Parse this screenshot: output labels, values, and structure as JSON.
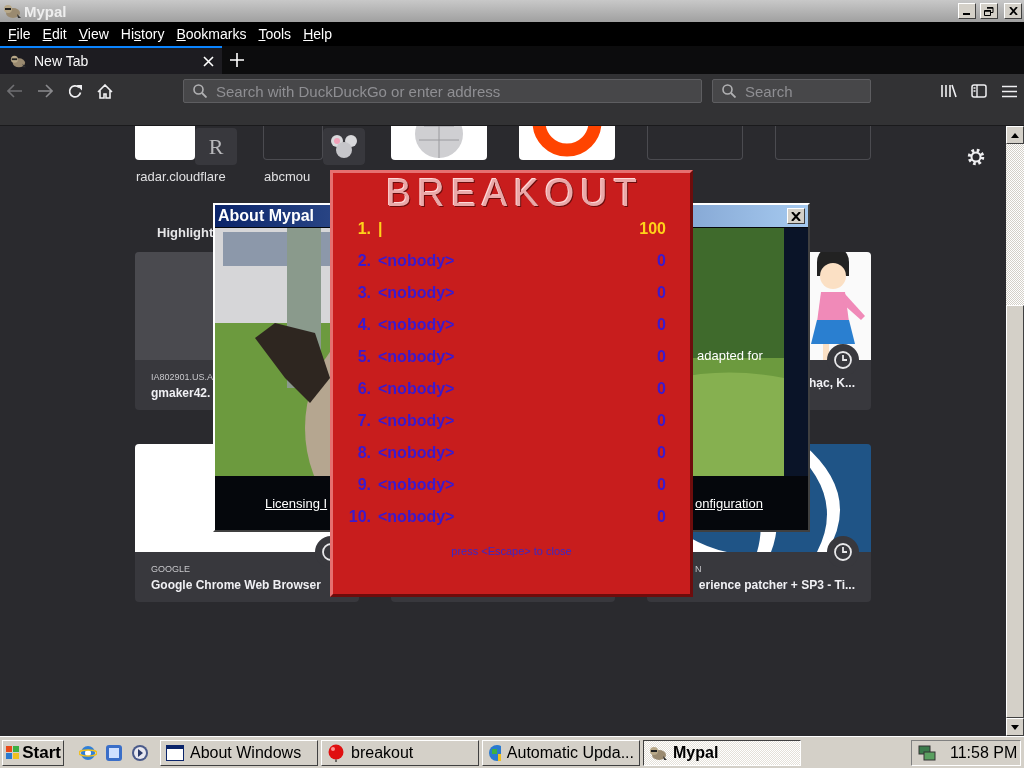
{
  "window": {
    "title": "Mypal"
  },
  "menu": [
    {
      "key": "F",
      "rest": "ile"
    },
    {
      "key": "E",
      "rest": "dit"
    },
    {
      "key": "V",
      "rest": "iew"
    },
    {
      "lead": "Hi",
      "key": "s",
      "rest": "tory"
    },
    {
      "key": "B",
      "rest": "ookmarks"
    },
    {
      "key": "T",
      "rest": "ools"
    },
    {
      "key": "H",
      "rest": "elp"
    }
  ],
  "tabs": [
    {
      "label": "New Tab",
      "selected": true
    }
  ],
  "toolbar": {
    "address_placeholder": "Search with DuckDuckGo or enter address",
    "search_placeholder": "Search"
  },
  "top_sites": [
    {
      "kind": "letter",
      "badge": "R",
      "label": "radar.cloudflare"
    },
    {
      "kind": "mouse",
      "label": "abcmou"
    },
    {
      "kind": "globe"
    },
    {
      "kind": "ring"
    },
    {
      "kind": "empty"
    },
    {
      "kind": "empty"
    }
  ],
  "highlights": {
    "title": "Highlight",
    "cards": [
      {
        "kind": "gray",
        "source": "IA802901.US.A",
        "title": "gmaker42."
      },
      {
        "kind": "figure",
        "title": "hạc, K...",
        "history": true
      },
      {
        "kind": "white",
        "source": "GOOGLE",
        "title": "Google Chrome Web Browser",
        "history": true
      },
      {
        "kind": "covered"
      },
      {
        "kind": "waves",
        "source": "N",
        "title": "erience patcher + SP3 - Ti...",
        "history": true
      }
    ]
  },
  "about": {
    "title": "About Mypal",
    "caption": "adapted for",
    "links": [
      "Licensing I",
      "onfiguration"
    ]
  },
  "breakout": {
    "title": "BREAKOUT",
    "scores": [
      {
        "rank": "1.",
        "name": "|",
        "score": "100",
        "current": true
      },
      {
        "rank": "2.",
        "name": "<nobody>",
        "score": "0",
        "current": false
      },
      {
        "rank": "3.",
        "name": "<nobody>",
        "score": "0",
        "current": false
      },
      {
        "rank": "4.",
        "name": "<nobody>",
        "score": "0",
        "current": false
      },
      {
        "rank": "5.",
        "name": "<nobody>",
        "score": "0",
        "current": false
      },
      {
        "rank": "6.",
        "name": "<nobody>",
        "score": "0",
        "current": false
      },
      {
        "rank": "7.",
        "name": "<nobody>",
        "score": "0",
        "current": false
      },
      {
        "rank": "8.",
        "name": "<nobody>",
        "score": "0",
        "current": false
      },
      {
        "rank": "9.",
        "name": "<nobody>",
        "score": "0",
        "current": false
      },
      {
        "rank": "10.",
        "name": "<nobody>",
        "score": "0",
        "current": false
      }
    ],
    "hint": "press <Escape> to close"
  },
  "taskbar": {
    "start": "Start",
    "tasks": [
      {
        "label": "About Windows",
        "kind": "window",
        "selected": false
      },
      {
        "label": "breakout",
        "kind": "ball",
        "selected": false
      },
      {
        "label": "Automatic Upda...",
        "kind": "update",
        "selected": false
      },
      {
        "label": "Mypal",
        "kind": "app",
        "selected": true
      }
    ],
    "clock": "11:58 PM"
  }
}
